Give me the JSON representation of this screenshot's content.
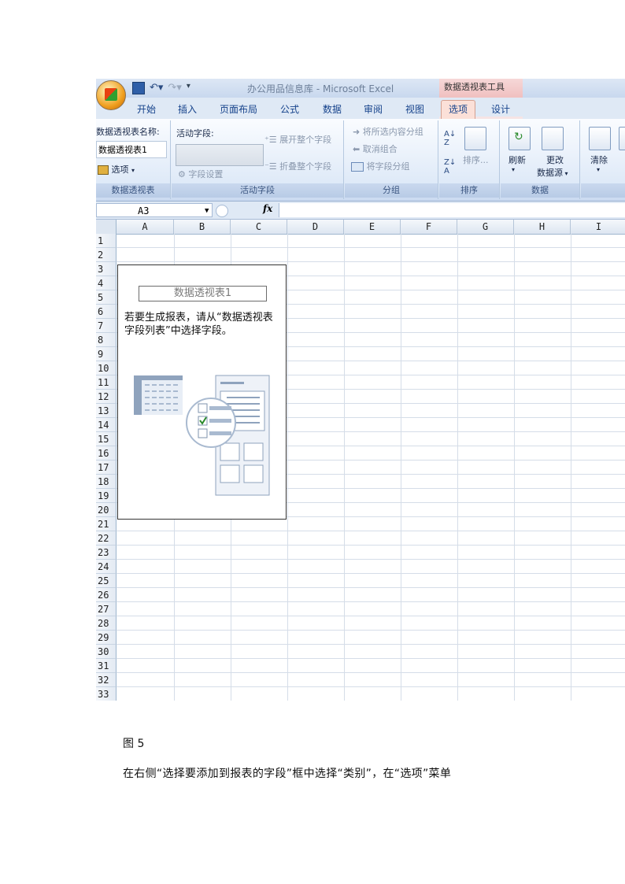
{
  "window": {
    "title": "办公用品信息库 - Microsoft Excel",
    "context_tool": "数据透视表工具"
  },
  "tabs": [
    {
      "label": "开始"
    },
    {
      "label": "插入"
    },
    {
      "label": "页面布局"
    },
    {
      "label": "公式"
    },
    {
      "label": "数据"
    },
    {
      "label": "审阅"
    },
    {
      "label": "视图"
    },
    {
      "label": "选项"
    },
    {
      "label": "设计"
    }
  ],
  "ribbon": {
    "pivot_group": {
      "name_label": "数据透视表名称:",
      "name_value": "数据透视表1",
      "options_button": "选项",
      "group_label": "数据透视表"
    },
    "active_field_group": {
      "label": "活动字段:",
      "expand": "展开整个字段",
      "collapse": "折叠整个字段",
      "field_settings": "字段设置",
      "group_label": "活动字段"
    },
    "group_group": {
      "group_selection": "将所选内容分组",
      "ungroup": "取消组合",
      "group_field": "将字段分组",
      "group_label": "分组"
    },
    "sort_group": {
      "sort": "排序...",
      "group_label": "排序"
    },
    "data_group": {
      "refresh": "刷新",
      "change_source_line1": "更改",
      "change_source_line2": "数据源",
      "group_label": "数据"
    },
    "clear": "清除"
  },
  "formula_bar": {
    "cell_ref": "A3",
    "fx": "fx",
    "value": ""
  },
  "columns": [
    "A",
    "B",
    "C",
    "D",
    "E",
    "F",
    "G",
    "H",
    "I"
  ],
  "rows": [
    "1",
    "2",
    "3",
    "4",
    "5",
    "6",
    "7",
    "8",
    "9",
    "10",
    "11",
    "12",
    "13",
    "14",
    "15",
    "16",
    "17",
    "18",
    "19",
    "20",
    "21",
    "22",
    "23",
    "24",
    "25",
    "26",
    "27",
    "28",
    "29",
    "30",
    "31",
    "32",
    "33"
  ],
  "pivot_placeholder": {
    "title": "数据透视表1",
    "message": "若要生成报表，请从“数据透视表字段列表”中选择字段。"
  },
  "document": {
    "caption": "图 5",
    "paragraph": "在右侧“选择要添加到报表的字段”框中选择“类别”，在“选项”菜单"
  }
}
